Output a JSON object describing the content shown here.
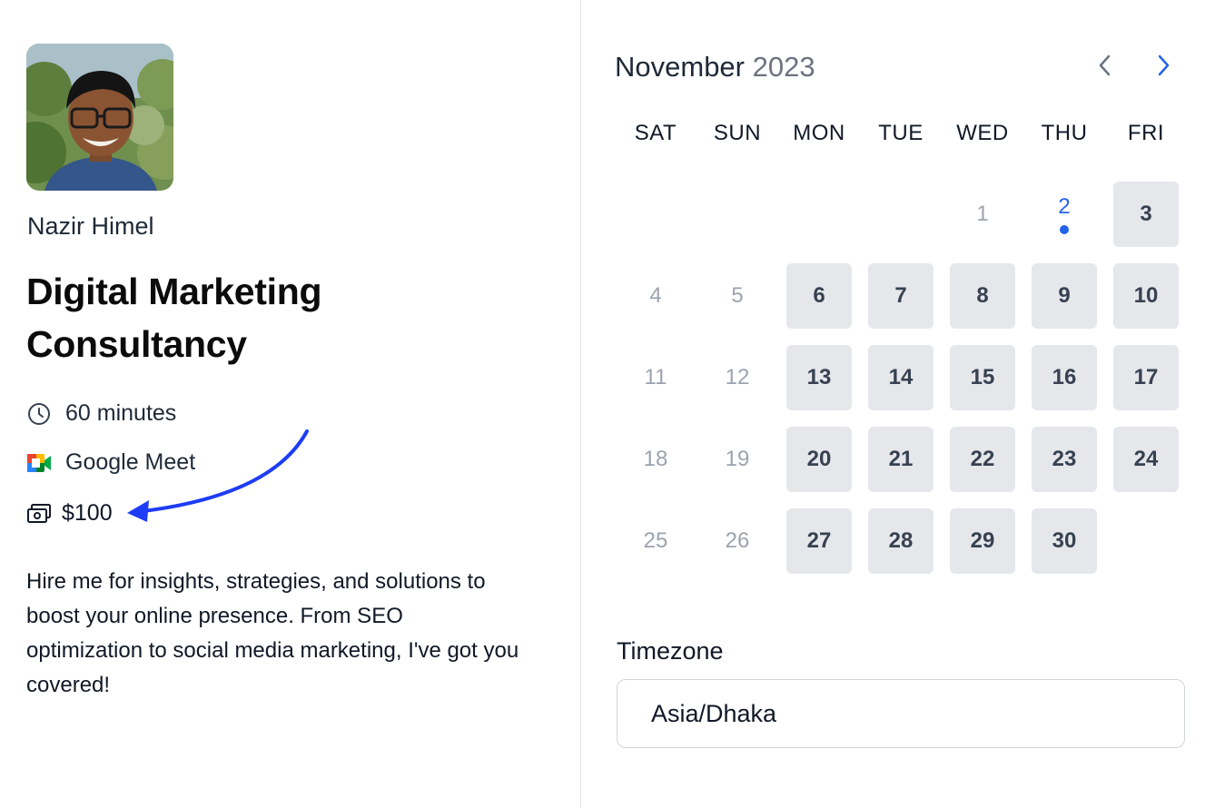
{
  "host": {
    "name": "Nazir Himel"
  },
  "event": {
    "title": "Digital Marketing Consultancy",
    "duration": "60 minutes",
    "location": "Google Meet",
    "price": "$100",
    "description": "Hire me for insights, strategies, and solutions to boost your online presence. From SEO optimization to social media marketing, I've got you covered!"
  },
  "calendar": {
    "month": "November",
    "year": "2023",
    "weekdays": [
      "SAT",
      "SUN",
      "MON",
      "TUE",
      "WED",
      "THU",
      "FRI"
    ],
    "days": [
      {
        "label": "1",
        "state": "unavailable"
      },
      {
        "label": "2",
        "state": "today"
      },
      {
        "label": "3",
        "state": "available"
      },
      {
        "label": "4",
        "state": "unavailable"
      },
      {
        "label": "5",
        "state": "unavailable"
      },
      {
        "label": "6",
        "state": "available"
      },
      {
        "label": "7",
        "state": "available"
      },
      {
        "label": "8",
        "state": "available"
      },
      {
        "label": "9",
        "state": "available"
      },
      {
        "label": "10",
        "state": "available"
      },
      {
        "label": "11",
        "state": "unavailable"
      },
      {
        "label": "12",
        "state": "unavailable"
      },
      {
        "label": "13",
        "state": "available"
      },
      {
        "label": "14",
        "state": "available"
      },
      {
        "label": "15",
        "state": "available"
      },
      {
        "label": "16",
        "state": "available"
      },
      {
        "label": "17",
        "state": "available"
      },
      {
        "label": "18",
        "state": "unavailable"
      },
      {
        "label": "19",
        "state": "unavailable"
      },
      {
        "label": "20",
        "state": "available"
      },
      {
        "label": "21",
        "state": "available"
      },
      {
        "label": "22",
        "state": "available"
      },
      {
        "label": "23",
        "state": "available"
      },
      {
        "label": "24",
        "state": "available"
      },
      {
        "label": "25",
        "state": "unavailable"
      },
      {
        "label": "26",
        "state": "unavailable"
      },
      {
        "label": "27",
        "state": "available"
      },
      {
        "label": "28",
        "state": "available"
      },
      {
        "label": "29",
        "state": "available"
      },
      {
        "label": "30",
        "state": "available"
      }
    ]
  },
  "timezone": {
    "label": "Timezone",
    "value": "Asia/Dhaka"
  },
  "icons": {
    "duration": "clock-icon",
    "location": "google-meet-icon",
    "price": "money-icon",
    "prev": "chevron-left-icon",
    "next": "chevron-right-icon"
  },
  "colors": {
    "accent": "#2563eb",
    "available_bg": "#e5e7eb",
    "annotation_arrow": "#1d3cf5"
  }
}
